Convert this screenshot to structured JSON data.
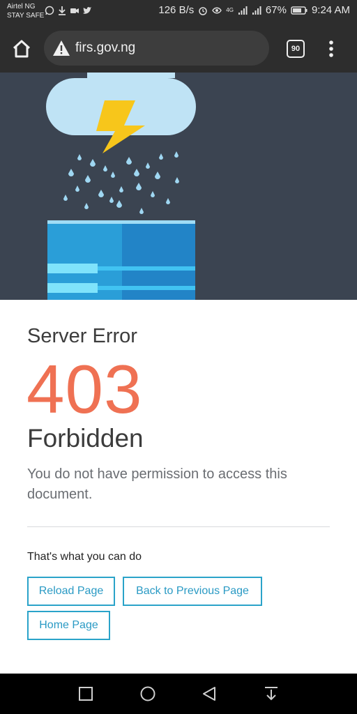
{
  "status_bar": {
    "carrier_line1": "Airtel NG",
    "carrier_line2": "STAY SAFE",
    "network_speed": "126 B/s",
    "network_type": "4G",
    "battery": "67%",
    "time": "9:24 AM"
  },
  "browser": {
    "url": "firs.gov.ng",
    "tab_count": "90"
  },
  "error": {
    "title": "Server Error",
    "code": "403",
    "status": "Forbidden",
    "message": "You do not have permission to access this document.",
    "actions_label": "That's what you can do",
    "buttons": {
      "reload": "Reload Page",
      "back": "Back to Previous Page",
      "home": "Home Page"
    }
  },
  "colors": {
    "accent": "#2aa3c9",
    "error_code": "#ef7153",
    "hero_bg": "#3b4451"
  }
}
